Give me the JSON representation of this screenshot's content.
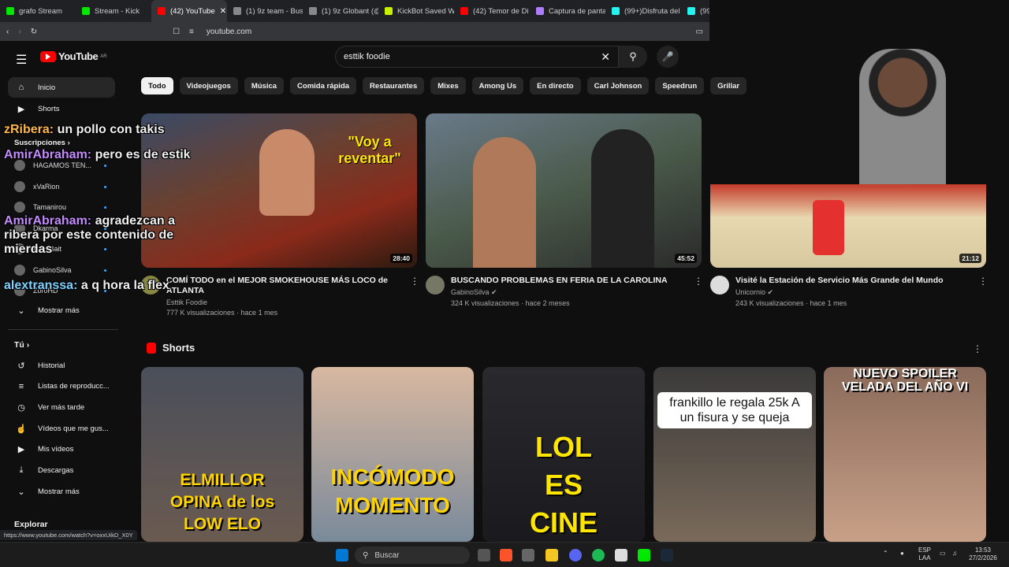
{
  "browser": {
    "tabs": [
      {
        "label": "grafo Stream",
        "color": "#00e701"
      },
      {
        "label": "Stream - Kick",
        "color": "#00e701"
      },
      {
        "label": "(42) YouTube",
        "color": "#ff0000",
        "active": true
      },
      {
        "label": "(1) 9z team - Bus",
        "color": "#888"
      },
      {
        "label": "(1) 9z Globant (@",
        "color": "#888"
      },
      {
        "label": "KickBot Saved W",
        "color": "#c7f000"
      },
      {
        "label": "(42) Temor de Di",
        "color": "#ff0000"
      },
      {
        "label": "Captura de panta",
        "color": "#b07cff"
      },
      {
        "label": "(99+)Disfruta del",
        "color": "#25f4ee"
      },
      {
        "label": "(99+)",
        "color": "#25f4ee"
      }
    ],
    "url": "youtube.com",
    "status_url": "https://www.youtube.com/watch?v=oxxUikD_X0Y"
  },
  "header": {
    "logo": "YouTube",
    "region": "AR",
    "search_value": "esttik foodie"
  },
  "chips": [
    "Todo",
    "Videojuegos",
    "Música",
    "Comida rápida",
    "Restaurantes",
    "Mixes",
    "Among Us",
    "En directo",
    "Carl Johnson",
    "Speedrun",
    "Grillar"
  ],
  "sidebar": {
    "home": "Inicio",
    "shorts": "Shorts",
    "subs_title": "Suscripciones",
    "subs": [
      "HAGAMOS TEN...",
      "xVaRion",
      "Tamanirou",
      "Dkarma",
      "BattyBait",
      "GabinoSilva",
      "ZoroHD"
    ],
    "more1": "Mostrar más",
    "you_title": "Tú",
    "you": [
      "Historial",
      "Listas de reproducc...",
      "Ver más tarde",
      "Vídeos que me gus...",
      "Mis vídeos",
      "Descargas"
    ],
    "more2": "Mostrar más",
    "explore": "Explorar"
  },
  "videos": [
    {
      "title": "COMÍ TODO en el MEJOR SMOKEHOUSE MÁS LOCO de ATLANTA",
      "channel": "Esttik Foodie",
      "meta": "777 K visualizaciones · hace 1 mes",
      "duration": "28:40",
      "overlay": "\"Voy a reventar\""
    },
    {
      "title": "BUSCANDO PROBLEMAS EN FERIA DE LA CAROLINA",
      "channel": "GabinoSilva",
      "meta": "324 K visualizaciones · hace 2 meses",
      "duration": "45:52"
    },
    {
      "title": "Visité la Estación de Servicio Más Grande del Mundo",
      "channel": "Unicornio",
      "meta": "243 K visualizaciones · hace 1 mes",
      "duration": "21:12"
    }
  ],
  "shorts": {
    "title": "Shorts",
    "items": [
      {
        "text": "ELMILLOR OPINA de los LOW ELO",
        "color": "#ffd400"
      },
      {
        "text": "INCÓMODO MOMENTO",
        "color": "#ffd400"
      },
      {
        "text": "LOL ES CINE",
        "color": "#ffe600"
      },
      {
        "text": "frankillo le regala 25k A un fisura y se queja",
        "color": "#111"
      },
      {
        "text": "NUEVO SPOILER VELADA DEL AÑO VI",
        "color": "#fff"
      }
    ]
  },
  "chat": [
    {
      "user": "zRibera:",
      "msg": "un pollo con takis",
      "ucolor": "#ffb84d"
    },
    {
      "user": "AmirAbraham:",
      "msg": "pero es de estik",
      "ucolor": "#c58cff"
    },
    {
      "user": "AmirAbraham:",
      "msg": "agradezcan a ribera por este contenido de mierdas",
      "ucolor": "#c58cff"
    },
    {
      "user": "alextranssa:",
      "msg": "a q hora la flex",
      "ucolor": "#7fd1ff"
    }
  ],
  "taskbar": {
    "search": "Buscar",
    "lang1": "ESP",
    "lang2": "LAA",
    "time": "13:53",
    "date": "27/2/2026"
  }
}
